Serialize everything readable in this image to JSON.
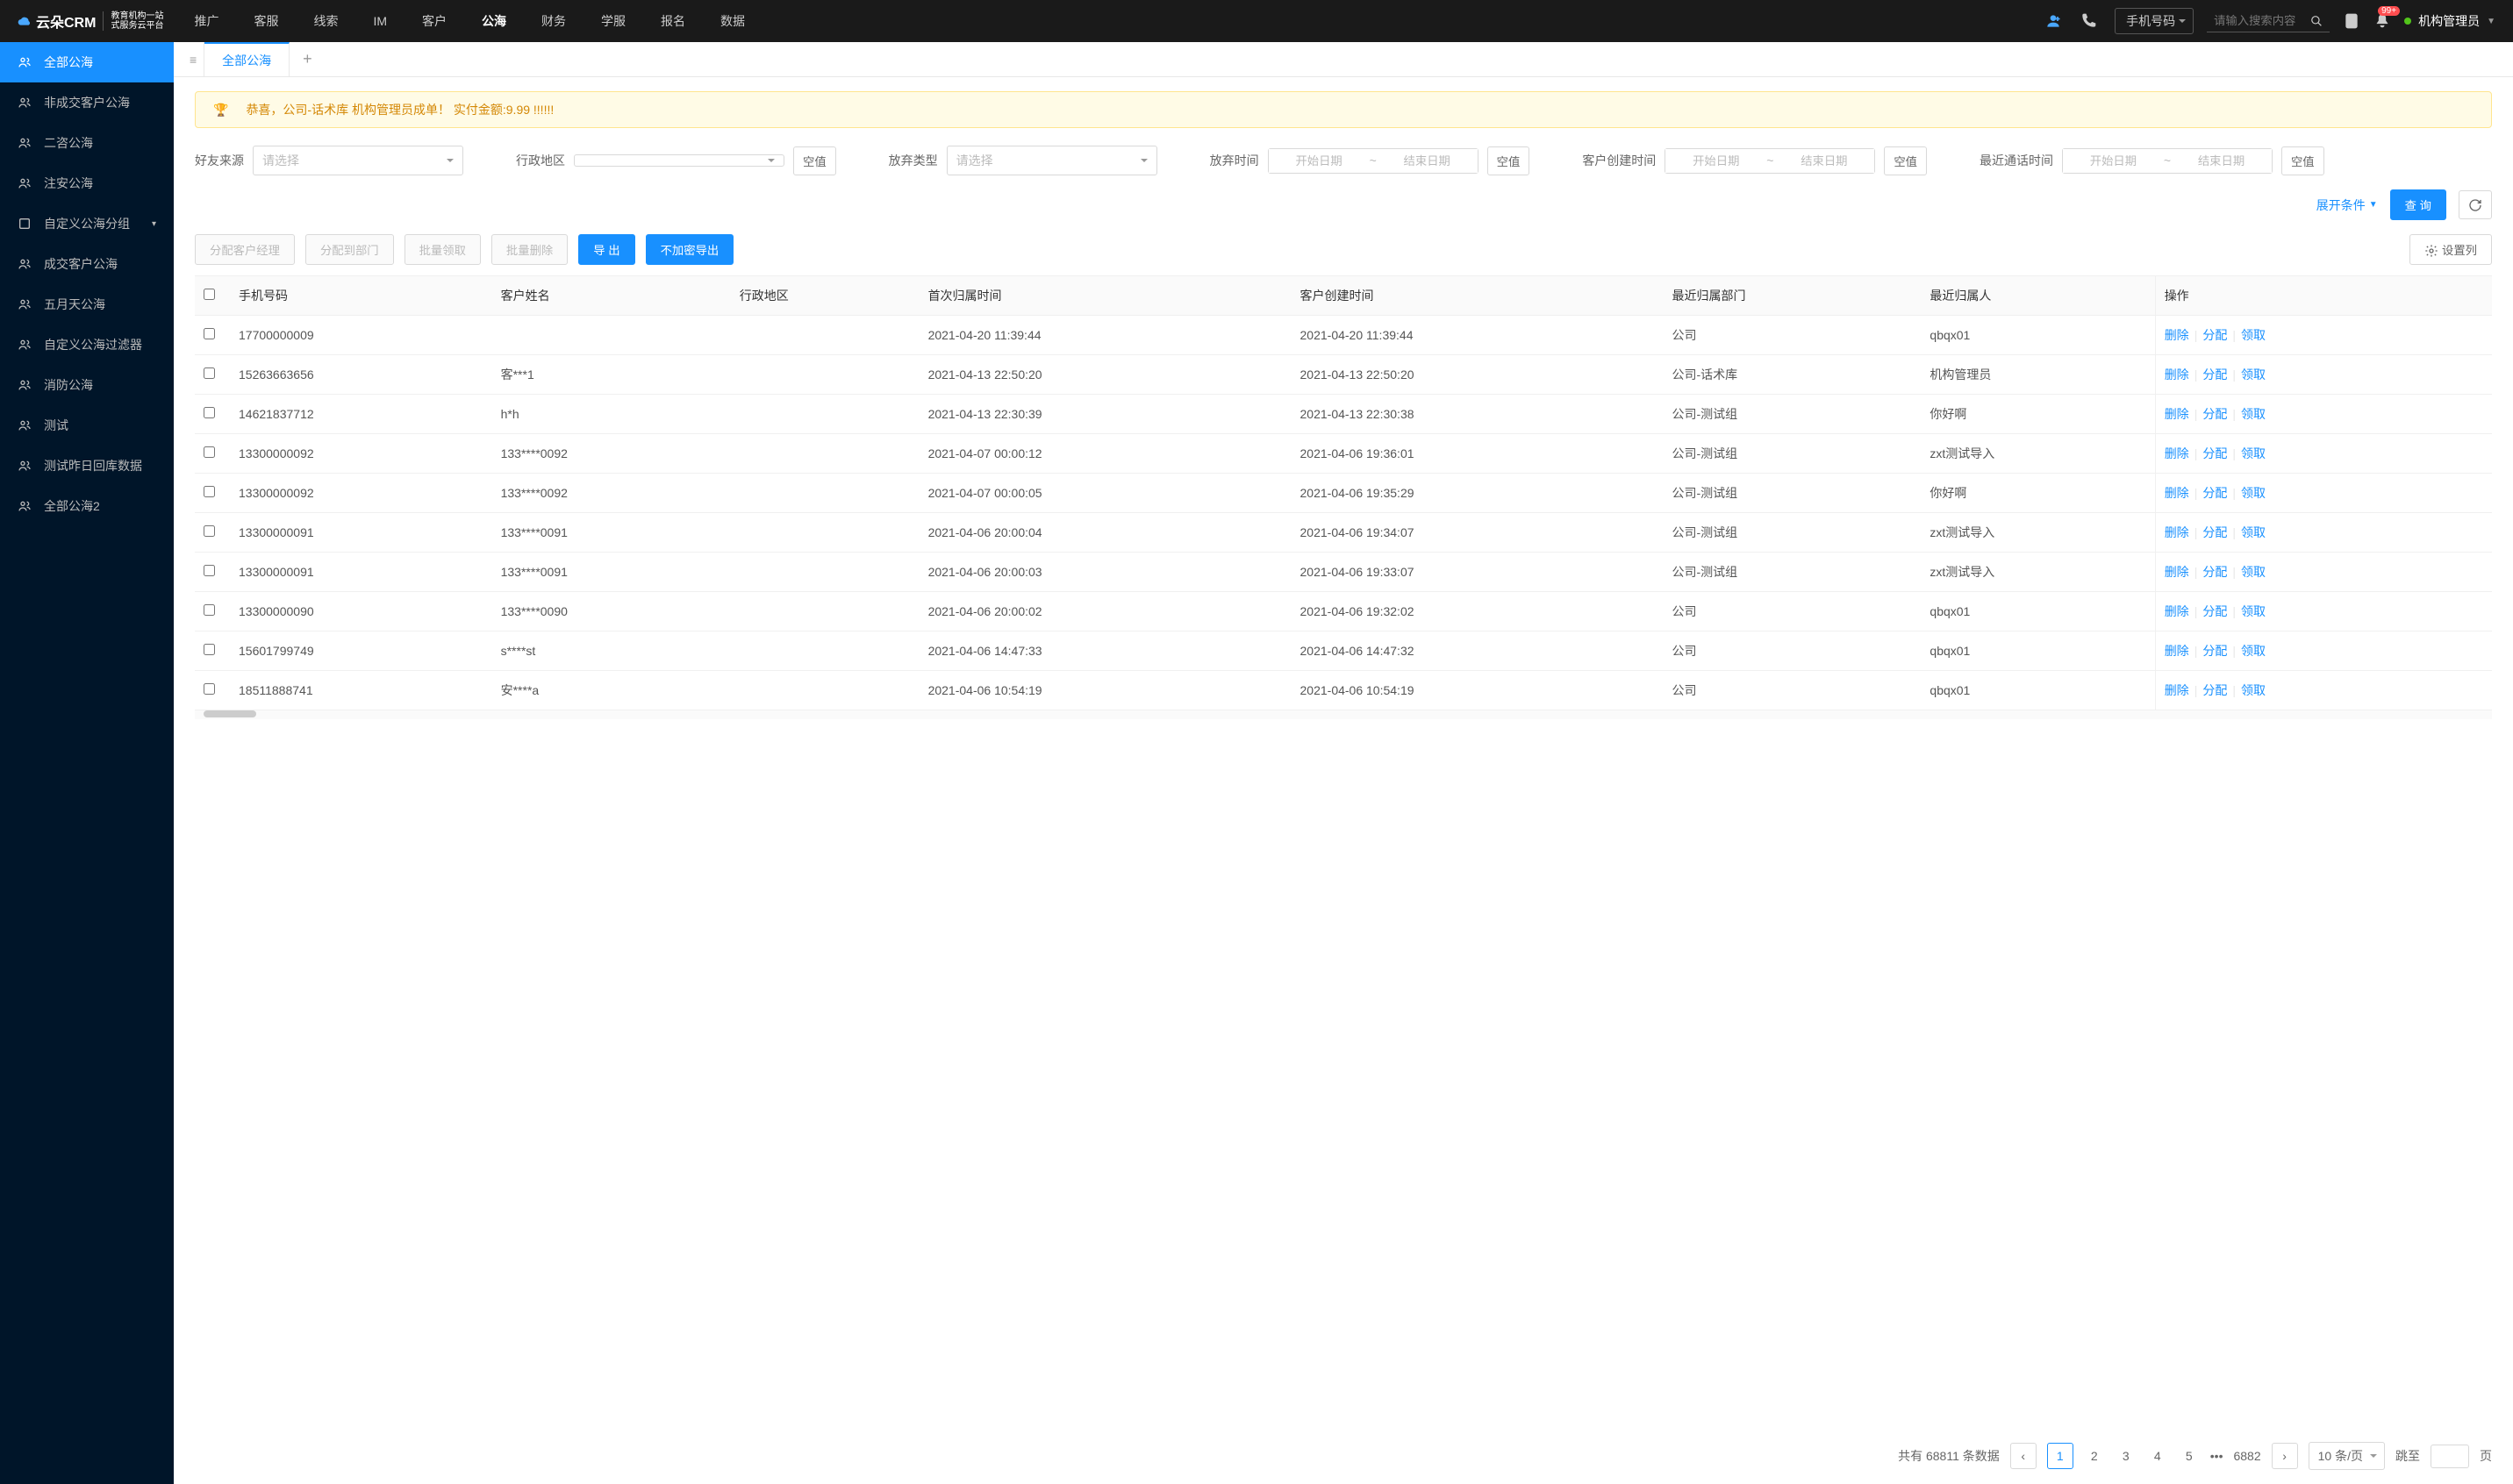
{
  "header": {
    "logo_main": "云朵CRM",
    "logo_sub1": "教育机构一站",
    "logo_sub2": "式服务云平台",
    "logo_url": "www.yunduocrm.com",
    "nav": [
      "推广",
      "客服",
      "线索",
      "IM",
      "客户",
      "公海",
      "财务",
      "学服",
      "报名",
      "数据"
    ],
    "nav_active": 5,
    "search_type": "手机号码",
    "search_placeholder": "请输入搜索内容",
    "badge": "99+",
    "user": "机构管理员"
  },
  "sidebar": {
    "items": [
      {
        "label": "全部公海",
        "active": true,
        "icon": "users"
      },
      {
        "label": "非成交客户公海",
        "icon": "users"
      },
      {
        "label": "二咨公海",
        "icon": "users"
      },
      {
        "label": "注安公海",
        "icon": "users"
      },
      {
        "label": "自定义公海分组",
        "chevron": true,
        "icon": "folder"
      },
      {
        "label": "成交客户公海",
        "icon": "users"
      },
      {
        "label": "五月天公海",
        "icon": "users"
      },
      {
        "label": "自定义公海过滤器",
        "icon": "users"
      },
      {
        "label": "消防公海",
        "icon": "users"
      },
      {
        "label": "测试",
        "icon": "users"
      },
      {
        "label": "测试昨日回库数据",
        "icon": "users"
      },
      {
        "label": "全部公海2",
        "icon": "users"
      }
    ]
  },
  "tabs": {
    "active": "全部公海"
  },
  "banner": "恭喜，公司-话术库  机构管理员成单！  实付金额:9.99 !!!!!!",
  "filters": {
    "friend_source": {
      "label": "好友来源",
      "placeholder": "请选择"
    },
    "region": {
      "label": "行政地区",
      "empty": "空值"
    },
    "abandon_type": {
      "label": "放弃类型",
      "placeholder": "请选择"
    },
    "abandon_time": {
      "label": "放弃时间",
      "start": "开始日期",
      "end": "结束日期",
      "empty": "空值"
    },
    "create_time": {
      "label": "客户创建时间",
      "start": "开始日期",
      "end": "结束日期",
      "empty": "空值"
    },
    "last_call": {
      "label": "最近通话时间",
      "start": "开始日期",
      "end": "结束日期",
      "empty": "空值"
    },
    "expand": "展开条件",
    "query": "查 询"
  },
  "toolbar": {
    "assign_manager": "分配客户经理",
    "assign_dept": "分配到部门",
    "batch_claim": "批量领取",
    "batch_delete": "批量删除",
    "export": "导 出",
    "export_plain": "不加密导出",
    "config_cols": "设置列"
  },
  "table": {
    "columns": [
      "手机号码",
      "客户姓名",
      "行政地区",
      "首次归属时间",
      "客户创建时间",
      "最近归属部门",
      "最近归属人",
      "操作"
    ],
    "ops": {
      "delete": "删除",
      "assign": "分配",
      "claim": "领取"
    },
    "rows": [
      {
        "phone": "17700000009",
        "name": "",
        "region": "",
        "first_time": "2021-04-20 11:39:44",
        "create_time": "2021-04-20 11:39:44",
        "dept": "公司",
        "owner": "qbqx01"
      },
      {
        "phone": "15263663656",
        "name": "客***1",
        "region": "",
        "first_time": "2021-04-13 22:50:20",
        "create_time": "2021-04-13 22:50:20",
        "dept": "公司-话术库",
        "owner": "机构管理员"
      },
      {
        "phone": "14621837712",
        "name": "h*h",
        "region": "",
        "first_time": "2021-04-13 22:30:39",
        "create_time": "2021-04-13 22:30:38",
        "dept": "公司-测试组",
        "owner": "你好啊"
      },
      {
        "phone": "13300000092",
        "name": "133****0092",
        "region": "",
        "first_time": "2021-04-07 00:00:12",
        "create_time": "2021-04-06 19:36:01",
        "dept": "公司-测试组",
        "owner": "zxt测试导入"
      },
      {
        "phone": "13300000092",
        "name": "133****0092",
        "region": "",
        "first_time": "2021-04-07 00:00:05",
        "create_time": "2021-04-06 19:35:29",
        "dept": "公司-测试组",
        "owner": "你好啊"
      },
      {
        "phone": "13300000091",
        "name": "133****0091",
        "region": "",
        "first_time": "2021-04-06 20:00:04",
        "create_time": "2021-04-06 19:34:07",
        "dept": "公司-测试组",
        "owner": "zxt测试导入"
      },
      {
        "phone": "13300000091",
        "name": "133****0091",
        "region": "",
        "first_time": "2021-04-06 20:00:03",
        "create_time": "2021-04-06 19:33:07",
        "dept": "公司-测试组",
        "owner": "zxt测试导入"
      },
      {
        "phone": "13300000090",
        "name": "133****0090",
        "region": "",
        "first_time": "2021-04-06 20:00:02",
        "create_time": "2021-04-06 19:32:02",
        "dept": "公司",
        "owner": "qbqx01"
      },
      {
        "phone": "15601799749",
        "name": "s****st",
        "region": "",
        "first_time": "2021-04-06 14:47:33",
        "create_time": "2021-04-06 14:47:32",
        "dept": "公司",
        "owner": "qbqx01"
      },
      {
        "phone": "18511888741",
        "name": "安****a",
        "region": "",
        "first_time": "2021-04-06 10:54:19",
        "create_time": "2021-04-06 10:54:19",
        "dept": "公司",
        "owner": "qbqx01"
      }
    ]
  },
  "pagination": {
    "total_prefix": "共有",
    "total": "68811",
    "total_suffix": "条数据",
    "pages": [
      "1",
      "2",
      "3",
      "4",
      "5"
    ],
    "last": "6882",
    "ellipsis": "•••",
    "page_size": "10 条/页",
    "jump": "跳至",
    "page_unit": "页"
  }
}
